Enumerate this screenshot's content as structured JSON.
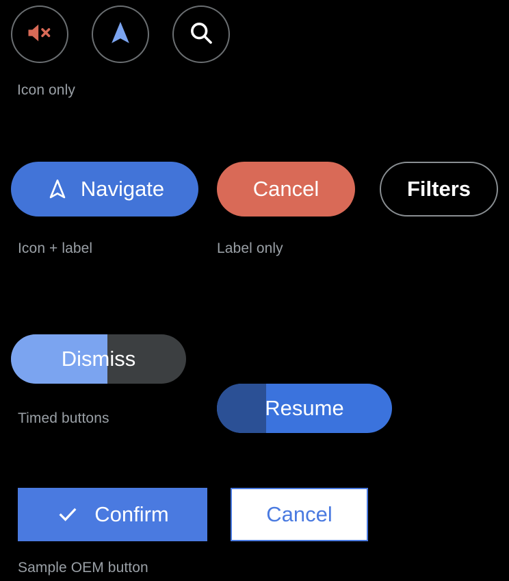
{
  "theme": {
    "background": "#000000",
    "caption_color": "#9aa0a6",
    "outline_color": "#6b6f72",
    "primary_blue": "#4274d8",
    "salmon_red": "#d96a57",
    "light_blue": "#7ba4f0",
    "dark_blue": "#2b5095",
    "track_gray": "#3c3f41",
    "oem_blue": "#4a7ae0",
    "white": "#ffffff"
  },
  "sections": [
    {
      "caption": "Icon only",
      "buttons": [
        {
          "name": "mute-button",
          "icon": "volume-off-icon",
          "icon_color": "#d96a57"
        },
        {
          "name": "navigate-button",
          "icon": "navigation-arrow-icon",
          "icon_color": "#7ba4f0"
        },
        {
          "name": "search-button",
          "icon": "search-icon",
          "icon_color": "#ffffff"
        }
      ]
    },
    {
      "caption_left": "Icon + label",
      "caption_right": "Label only",
      "buttons": [
        {
          "name": "navigate-pill",
          "label": "Navigate",
          "icon": "navigation-arrow-outline-icon",
          "style": "filled",
          "fill": "#4274d8",
          "text_color": "#ffffff"
        },
        {
          "name": "cancel-pill",
          "label": "Cancel",
          "icon": null,
          "style": "filled",
          "fill": "#d96a57",
          "text_color": "#ffffff"
        },
        {
          "name": "filters-pill",
          "label": "Filters",
          "icon": null,
          "style": "outlined",
          "fill": "transparent",
          "text_color": "#ffffff"
        }
      ]
    },
    {
      "caption": "Timed buttons",
      "buttons": [
        {
          "name": "dismiss-timed-button",
          "label": "Dismiss",
          "progress": 55,
          "fill": "#7ba4f0",
          "track": "#3c3f41"
        },
        {
          "name": "resume-timed-button",
          "label": "Resume",
          "progress": 28,
          "fill": "#2b5095",
          "track": "#3b73dd"
        }
      ]
    },
    {
      "caption": "Sample OEM button",
      "buttons": [
        {
          "name": "confirm-oem-button",
          "label": "Confirm",
          "icon": "check-icon",
          "fill": "#4a7ae0",
          "text_color": "#ffffff",
          "border": "none"
        },
        {
          "name": "cancel-oem-button",
          "label": "Cancel",
          "icon": null,
          "fill": "#ffffff",
          "text_color": "#4a7ae0",
          "border": "#4a7ae0"
        }
      ]
    }
  ]
}
